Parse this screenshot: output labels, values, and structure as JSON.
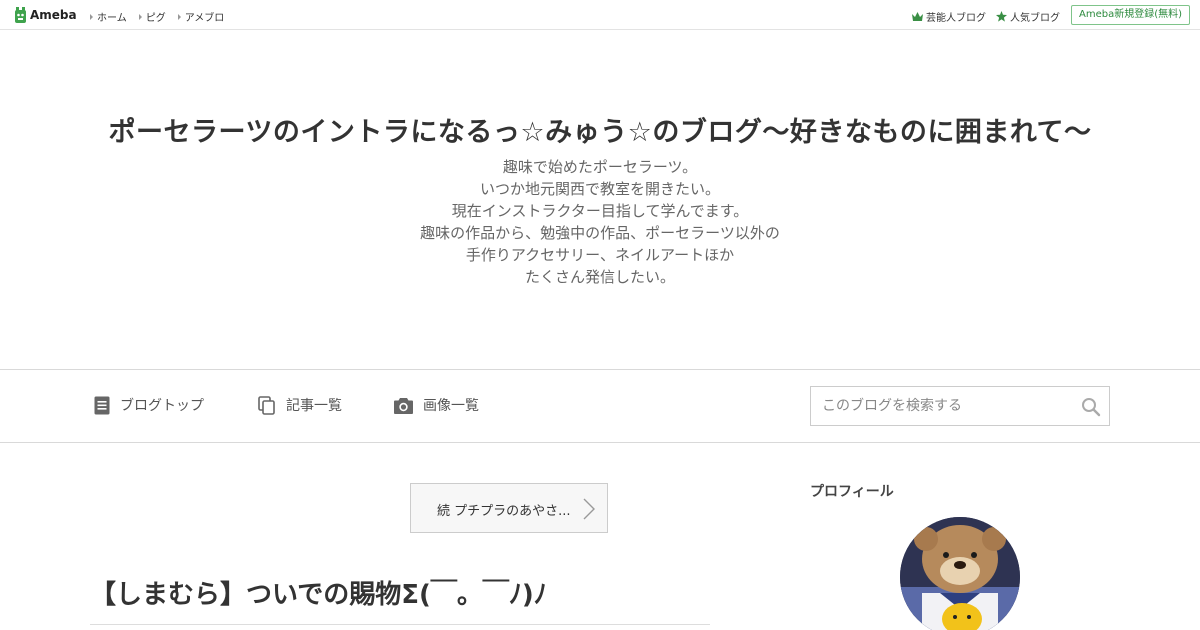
{
  "topbar": {
    "logo_text": "Ameba",
    "nav": [
      "ホーム",
      "ピグ",
      "アメブロ"
    ],
    "right_links": [
      {
        "icon": "crown-icon",
        "label": "芸能人ブログ"
      },
      {
        "icon": "star-icon",
        "label": "人気ブログ"
      }
    ],
    "signup_label": "Ameba新規登録(無料)"
  },
  "header": {
    "title": "ポーセラーツのイントラになるっ☆みゅう☆のブログ〜好きなものに囲まれて〜",
    "description": [
      "趣味で始めたポーセラーツ。",
      "いつか地元関西で教室を開きたい。",
      "現在インストラクター目指して学んでます。",
      "趣味の作品から、勉強中の作品、ポーセラーツ以外の",
      "手作りアクセサリー、ネイルアートほか",
      "たくさん発信したい。"
    ]
  },
  "navbar": {
    "items": [
      {
        "icon": "document-icon",
        "label": "ブログトップ"
      },
      {
        "icon": "copy-icon",
        "label": "記事一覧"
      },
      {
        "icon": "camera-icon",
        "label": "画像一覧"
      }
    ],
    "search_placeholder": "このブログを検索する"
  },
  "main": {
    "related_link": "続 プチプラのあやさ...",
    "entry_title": "【しまむら】ついでの賜物Σ(￣。￣ﾉ)ﾉ"
  },
  "sidebar": {
    "profile_heading": "プロフィール"
  },
  "colors": {
    "accent_green": "#2d8a3e",
    "logo_green": "#3fa34d"
  }
}
